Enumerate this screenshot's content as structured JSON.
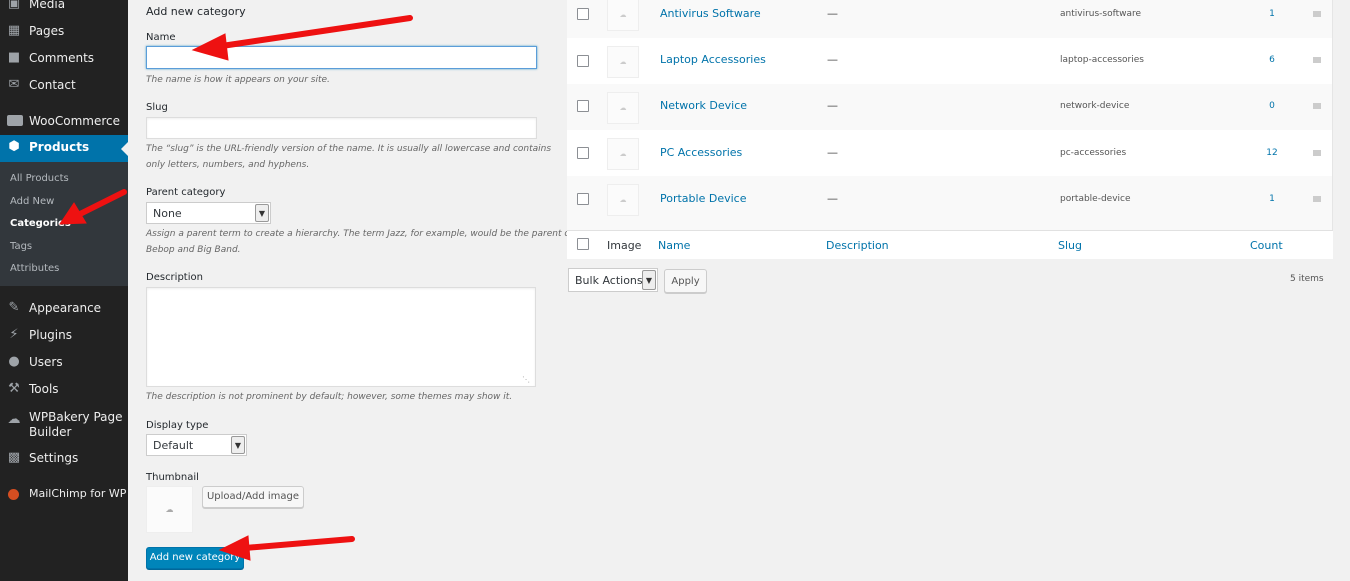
{
  "sidebar": {
    "items": [
      {
        "label": "Media",
        "icon": "media-icon"
      },
      {
        "label": "Pages",
        "icon": "pages-icon"
      },
      {
        "label": "Comments",
        "icon": "comments-icon"
      },
      {
        "label": "Contact",
        "icon": "mail-icon"
      },
      {
        "label": "WooCommerce",
        "icon": "woocommerce-icon"
      },
      {
        "label": "Products",
        "icon": "products-icon"
      },
      {
        "label": "Appearance",
        "icon": "appearance-icon"
      },
      {
        "label": "Plugins",
        "icon": "plugins-icon"
      },
      {
        "label": "Users",
        "icon": "users-icon"
      },
      {
        "label": "Tools",
        "icon": "tools-icon"
      },
      {
        "label": "WPBakery Page Builder",
        "icon": "wpbakery-icon"
      },
      {
        "label": "Settings",
        "icon": "settings-icon"
      },
      {
        "label": "MailChimp for WP",
        "icon": "mailchimp-icon"
      }
    ],
    "submenu": [
      "All Products",
      "Add New",
      "Categories",
      "Tags",
      "Attributes"
    ],
    "active_item": "Products",
    "current_submenu": "Categories"
  },
  "form": {
    "heading": "Add new category",
    "name_label": "Name",
    "name_value": "",
    "name_help": "The name is how it appears on your site.",
    "slug_label": "Slug",
    "slug_value": "",
    "slug_help_1": "The “slug” is the URL-friendly version of the name. It is usually all lowercase and contains",
    "slug_help_2": "only letters, numbers, and hyphens.",
    "parent_label": "Parent category",
    "parent_value": "None",
    "parent_help_1": "Assign a parent term to create a hierarchy. The term Jazz, for example, would be the parent of",
    "parent_help_2": "Bebop and Big Band.",
    "description_label": "Description",
    "description_value": "",
    "description_help": "The description is not prominent by default; however, some themes may show it.",
    "display_type_label": "Display type",
    "display_type_value": "Default",
    "thumbnail_label": "Thumbnail",
    "upload_button": "Upload/Add image",
    "submit_button": "Add new category"
  },
  "table": {
    "rows": [
      {
        "name": "Antivirus Software",
        "description": "—",
        "slug": "antivirus-software",
        "count": "1"
      },
      {
        "name": "Laptop Accessories",
        "description": "—",
        "slug": "laptop-accessories",
        "count": "6"
      },
      {
        "name": "Network Device",
        "description": "—",
        "slug": "network-device",
        "count": "0"
      },
      {
        "name": "PC Accessories",
        "description": "—",
        "slug": "pc-accessories",
        "count": "12"
      },
      {
        "name": "Portable Device",
        "description": "—",
        "slug": "portable-device",
        "count": "1"
      }
    ],
    "footer": {
      "image": "Image",
      "name": "Name",
      "description": "Description",
      "slug": "Slug",
      "count": "Count"
    },
    "bulk_actions": "Bulk Actions",
    "apply_button": "Apply",
    "items_count": "5 items"
  },
  "colors": {
    "sidebar_bg": "#222222",
    "submenu_bg": "#32373c",
    "accent": "#0073aa",
    "primary_button": "#0085ba",
    "annotation_arrow": "#ee1111"
  }
}
